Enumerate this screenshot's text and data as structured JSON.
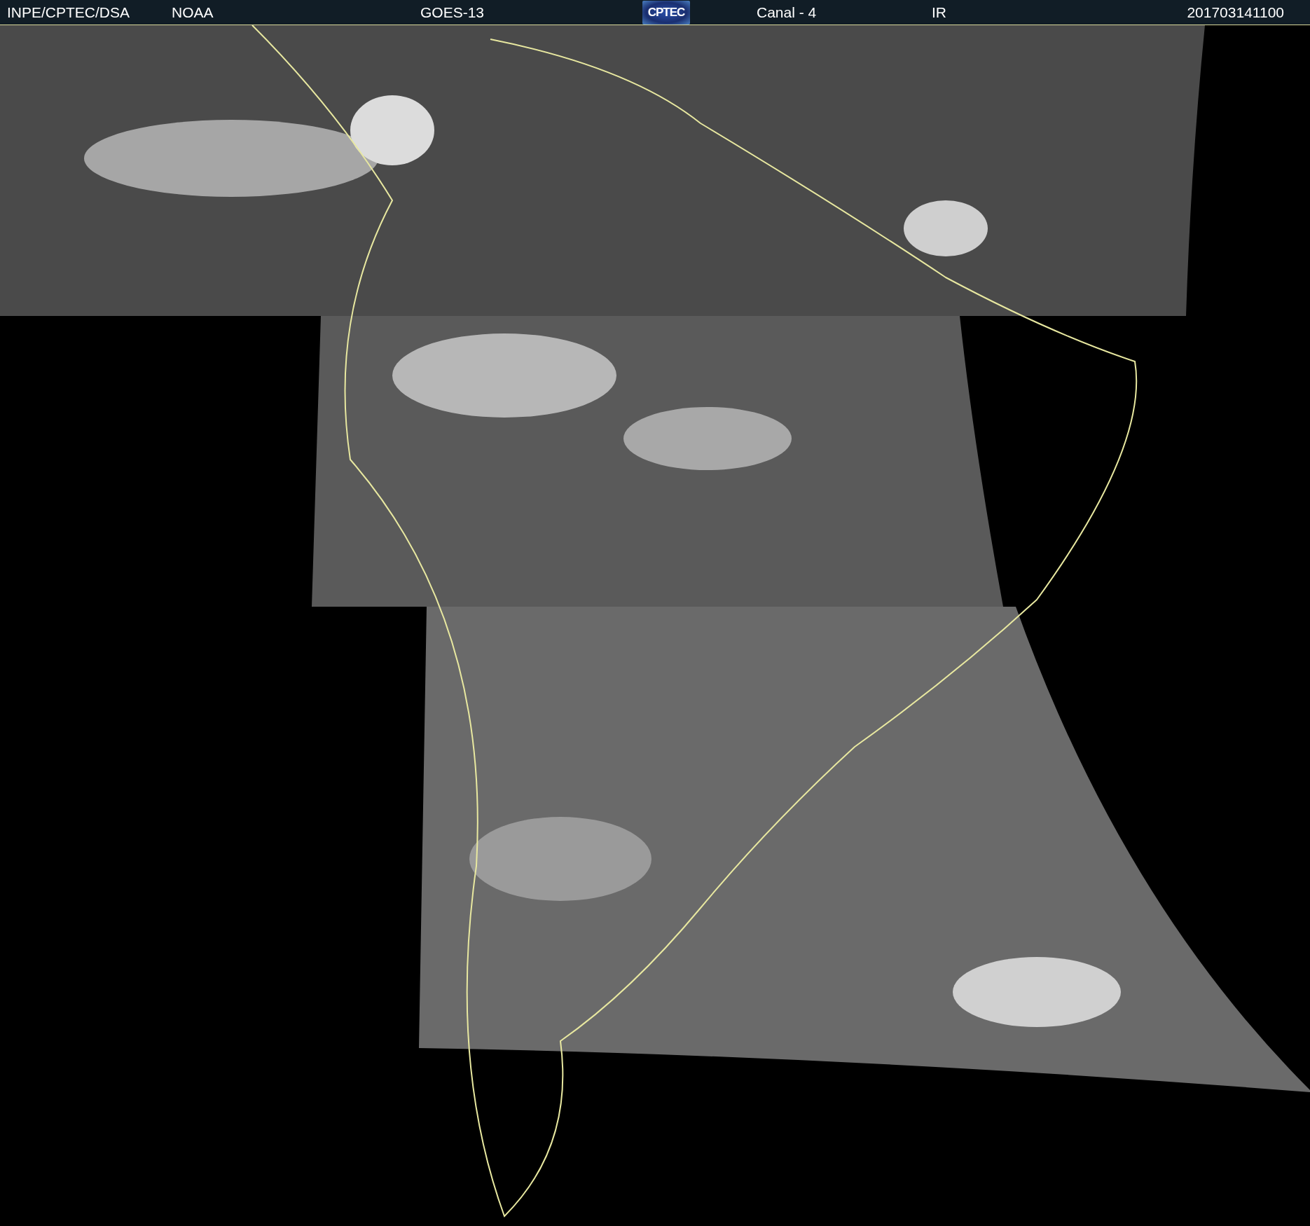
{
  "header": {
    "items": [
      {
        "kind": "text",
        "text": "INPE/CPTEC/DSA"
      },
      {
        "kind": "text",
        "text": "NOAA"
      },
      {
        "kind": "text",
        "text": "GOES-13"
      },
      {
        "kind": "logo",
        "text": "CPTEC"
      },
      {
        "kind": "text",
        "text": "Canal - 4"
      },
      {
        "kind": "text",
        "text": "IR"
      },
      {
        "kind": "text",
        "text": "201703141100"
      }
    ]
  }
}
